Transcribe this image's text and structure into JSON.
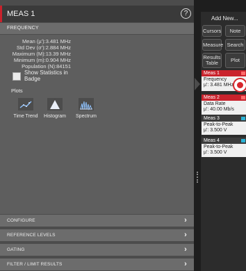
{
  "panel": {
    "title": "MEAS 1",
    "help_label": "?"
  },
  "frequency": {
    "section_label": "FREQUENCY",
    "stats": [
      {
        "label": "Mean (µ'):",
        "value": "3.481 MHz"
      },
      {
        "label": "Std Dev (σ'):",
        "value": "2.884 MHz"
      },
      {
        "label": "Maximum (M):",
        "value": "13.39 MHz"
      },
      {
        "label": "Minimum (m):",
        "value": "0.904 MHz"
      },
      {
        "label": "Population (N):",
        "value": "84151"
      }
    ],
    "show_stats_label": "Show Statistics in Badge",
    "show_stats_checked": false,
    "plots_label": "Plots",
    "plots": [
      {
        "label": "Time Trend",
        "icon": "time-trend-icon"
      },
      {
        "label": "Histogram",
        "icon": "histogram-icon"
      },
      {
        "label": "Spectrum",
        "icon": "spectrum-icon"
      }
    ]
  },
  "sections": [
    {
      "label": "CONFIGURE"
    },
    {
      "label": "REFERENCE LEVELS"
    },
    {
      "label": "GATING"
    },
    {
      "label": "FILTER / LIMIT RESULTS"
    }
  ],
  "chevron": "›",
  "add_new": {
    "title": "Add New...",
    "buttons": [
      "Cursors",
      "Note",
      "Measure",
      "Search",
      "Results Table",
      "Plot"
    ]
  },
  "badges": [
    {
      "name": "Meas 1",
      "measurement": "Frequency",
      "value": "µ': 3.481 MHz",
      "color": "#c9222c"
    },
    {
      "name": "Meas 2",
      "measurement": "Data Rate",
      "value": "µ': 40.00 Mb/s",
      "color": "#c9222c"
    },
    {
      "name": "Meas 3",
      "measurement": "Peak-to-Peak",
      "value": "µ': 3.500 V",
      "color": "#2ab3d6"
    },
    {
      "name": "Meas 4",
      "measurement": "Peak-to-Peak",
      "value": "µ': 3.500 V",
      "color": "#2ab3d6"
    }
  ],
  "colors": {
    "accent_red": "#c9222c",
    "accent_cyan": "#2ab3d6",
    "panel_gray": "#5e5e5e"
  }
}
